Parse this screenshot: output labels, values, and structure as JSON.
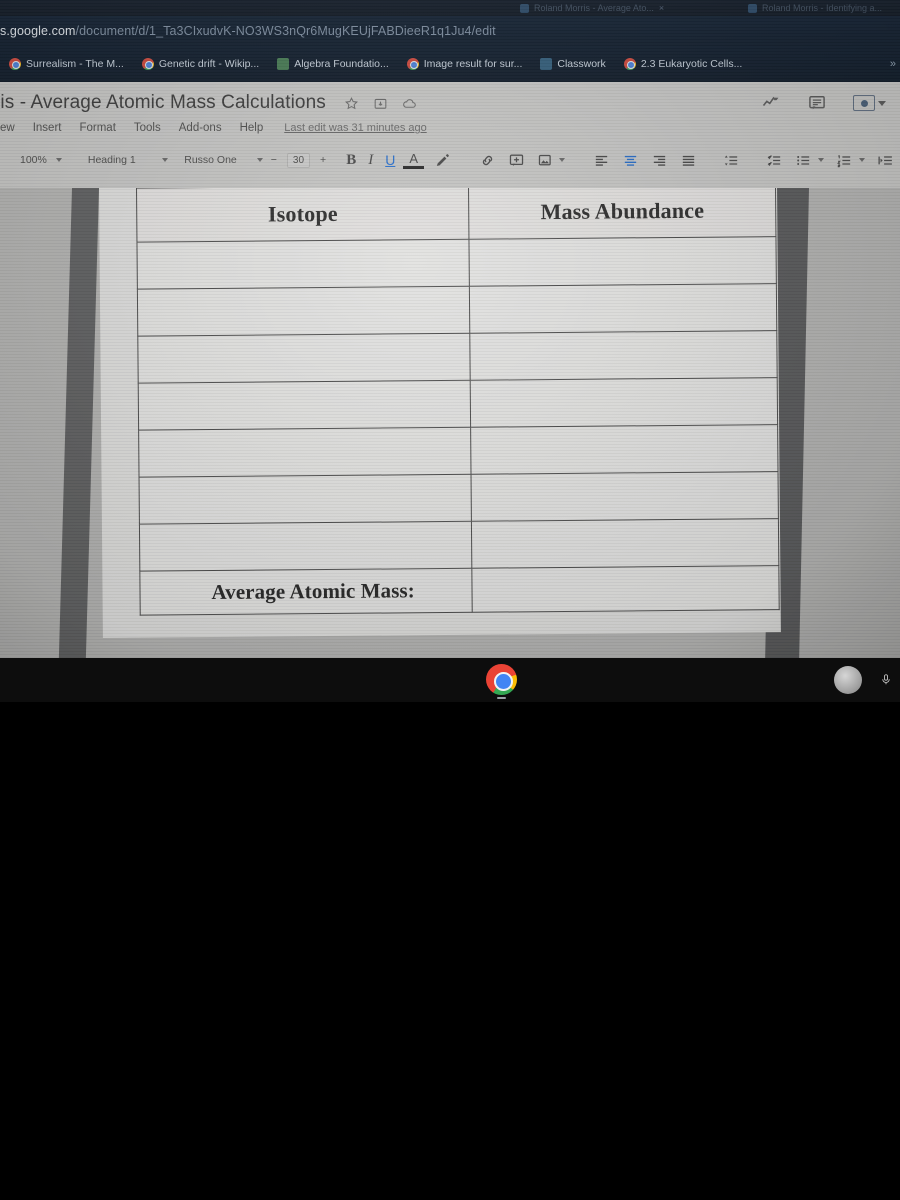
{
  "browser": {
    "tabs": [
      {
        "title": "Roland Morris - Average Ato...",
        "close_label": "×"
      },
      {
        "title": "Roland Morris - Identifying a..."
      }
    ],
    "url": {
      "host": "s.google.com",
      "path": "/document/d/1_Ta3CIxudvK-NO3WS3nQr6MugKEUjFABDieeR1q1Ju4/edit"
    },
    "bookmarks": [
      {
        "label": "Surrealism - The M...",
        "icon": "chrome-icon"
      },
      {
        "label": "Genetic drift - Wikip...",
        "icon": "chrome-icon"
      },
      {
        "label": "Algebra Foundatio...",
        "icon": "docs-icon"
      },
      {
        "label": "Image result for sur...",
        "icon": "chrome-icon"
      },
      {
        "label": "Classwork",
        "icon": "classroom-icon"
      },
      {
        "label": "2.3 Eukaryotic Cells...",
        "icon": "chrome-icon"
      }
    ],
    "bookmarks_overflow": "»"
  },
  "docs": {
    "title": "ris - Average Atomic Mass Calculations",
    "title_icons": [
      "star-icon",
      "move-to-folder-icon",
      "offline-cloud-icon"
    ],
    "menus": [
      "ew",
      "Insert",
      "Format",
      "Tools",
      "Add-ons",
      "Help"
    ],
    "last_edit": "Last edit was 31 minutes ago",
    "right_icons": [
      "editing-mode-icon",
      "comment-icon"
    ],
    "share_button": "share-lock-button"
  },
  "toolbar": {
    "zoom": "100%",
    "paragraph_style": "Heading 1",
    "font": "Russo One",
    "font_size": "30",
    "decrease_font": "−",
    "increase_font": "+",
    "bold": "B",
    "italic": "I",
    "underline": "U",
    "text_color": "A",
    "highlight": "highlight-pen-icon",
    "insert_link": "link-icon",
    "add_comment": "comment-plus-icon",
    "insert_image": "image-icon",
    "align_left": "align-left-icon",
    "align_center": "align-center-icon",
    "align_right": "align-right-icon",
    "align_justify": "align-justify-icon",
    "line_spacing": "line-spacing-icon",
    "checklist": "checklist-icon",
    "bulleted_list": "bulleted-list-icon",
    "numbered_list": "numbered-list-icon",
    "indent": "indent-icon",
    "active_buttons": [
      "underline",
      "align_center"
    ]
  },
  "document": {
    "table": {
      "headers": [
        "Isotope",
        "Mass Abundance"
      ],
      "empty_rows": 7,
      "footer_label": "Average Atomic Mass:",
      "footer_value": ""
    }
  },
  "shelf": {
    "items": [
      "chrome-launcher-icon"
    ],
    "status": [
      "user-avatar",
      "microphone-icon"
    ]
  }
}
